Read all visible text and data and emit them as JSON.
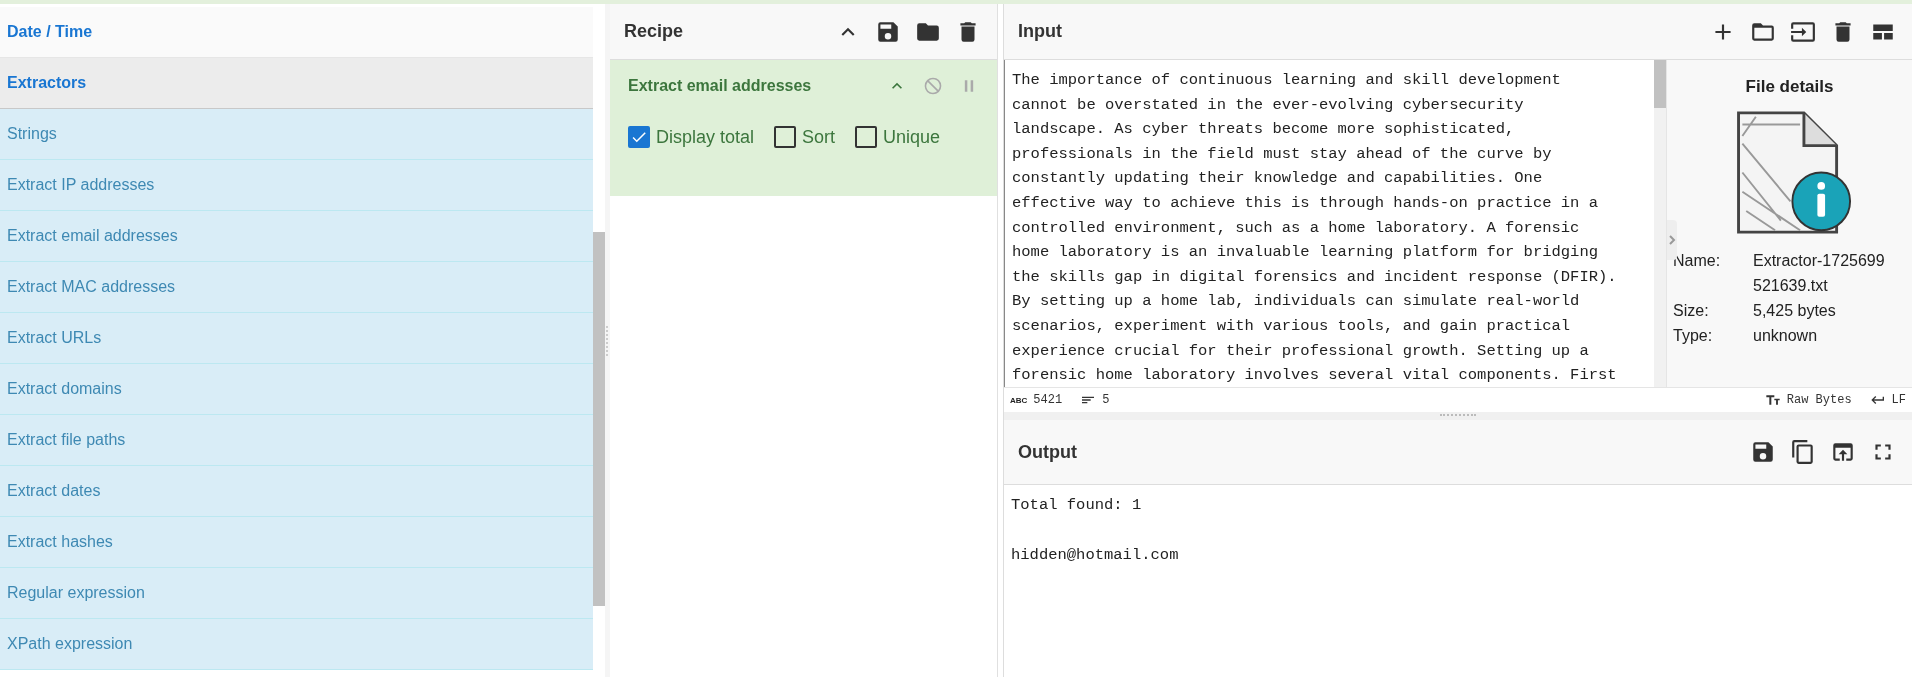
{
  "categories": [
    {
      "label": "Date / Time",
      "expanded": false
    },
    {
      "label": "Extractors",
      "expanded": true,
      "children": [
        {
          "label": "Strings"
        },
        {
          "label": "Extract IP addresses"
        },
        {
          "label": "Extract email addresses"
        },
        {
          "label": "Extract MAC addresses"
        },
        {
          "label": "Extract URLs"
        },
        {
          "label": "Extract domains"
        },
        {
          "label": "Extract file paths"
        },
        {
          "label": "Extract dates"
        },
        {
          "label": "Extract hashes"
        },
        {
          "label": "Regular expression"
        },
        {
          "label": "XPath expression"
        }
      ]
    }
  ],
  "recipe": {
    "title": "Recipe",
    "operations": [
      {
        "name": "Extract email addresses",
        "args": [
          {
            "label": "Display total",
            "checked": true
          },
          {
            "label": "Sort",
            "checked": false
          },
          {
            "label": "Unique",
            "checked": false
          }
        ]
      }
    ]
  },
  "input": {
    "title": "Input",
    "lines": [
      "The importance of continuous learning and skill development",
      "cannot be overstated in the ever-evolving cybersecurity",
      "landscape. As cyber threats become more sophisticated,",
      "professionals in the field must stay ahead of the curve by",
      "constantly updating their knowledge and capabilities. One",
      "effective way to achieve this is through hands-on practice in a",
      "controlled environment, such as a home laboratory. A forensic",
      "home laboratory is an invaluable learning platform for bridging",
      "the skills gap in digital forensics and incident response (DFIR).",
      "By setting up a home lab, individuals can simulate real-world",
      "scenarios, experiment with various tools, and gain practical",
      "experience crucial for their professional growth. Setting up a",
      "forensic home laboratory involves several vital components. First"
    ],
    "file_details": {
      "title": "File details",
      "fields": [
        {
          "label": "Name:",
          "value": "Extractor-1725699521639.txt"
        },
        {
          "label": "Size:",
          "value": "5,425 bytes"
        },
        {
          "label": "Type:",
          "value": "unknown"
        }
      ]
    },
    "status": {
      "length_label": "ABC",
      "length": "5421",
      "line_count": "5",
      "encoding": "Raw Bytes",
      "eol": "LF"
    }
  },
  "output": {
    "title": "Output",
    "text": "Total found: 1\n\nhidden@hotmail.com"
  }
}
